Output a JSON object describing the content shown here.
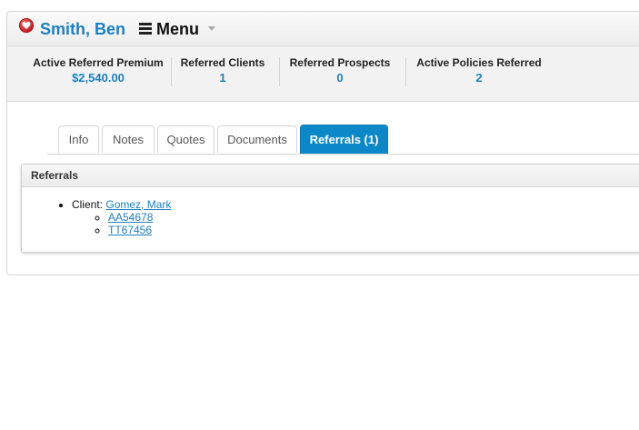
{
  "header": {
    "name": "Smith, Ben",
    "menu_label": "Menu",
    "icons": {
      "favorite": "heart-icon",
      "menu": "hamburger-icon",
      "caret": "chevron-down-icon"
    }
  },
  "stats": [
    {
      "label": "Active Referred Premium",
      "value": "$2,540.00"
    },
    {
      "label": "Referred Clients",
      "value": "1"
    },
    {
      "label": "Referred Prospects",
      "value": "0"
    },
    {
      "label": "Active Policies Referred",
      "value": "2"
    }
  ],
  "tabs": [
    {
      "label": "Info",
      "active": false
    },
    {
      "label": "Notes",
      "active": false
    },
    {
      "label": "Quotes",
      "active": false
    },
    {
      "label": "Documents",
      "active": false
    },
    {
      "label": "Referrals (1)",
      "active": true
    }
  ],
  "referrals": {
    "title": "Referrals",
    "client_prefix": "Client:",
    "client_name": "Gomez, Mark",
    "policies": [
      "AA54678",
      "TT67456"
    ]
  },
  "colors": {
    "accent": "#0c88c9",
    "link": "#1e7fbf",
    "heart": "#c31f1f"
  }
}
